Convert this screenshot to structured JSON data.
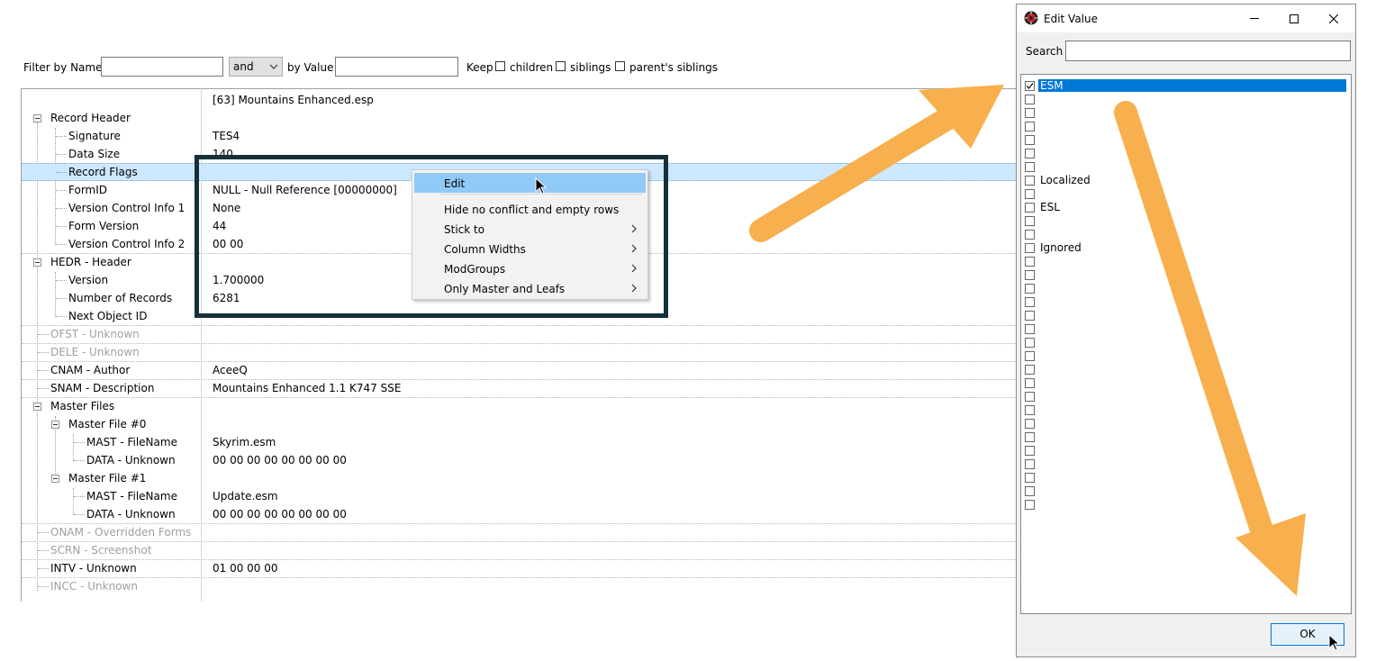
{
  "filter": {
    "name_label": "Filter by Name:",
    "name_value": "",
    "combo_value": "and",
    "value_label": "by Value:",
    "value_value": "",
    "keep_label": "Keep",
    "children_label": "children",
    "siblings_label": "siblings",
    "parents_siblings_label": "parent's siblings"
  },
  "grid": {
    "header_value": "[63] Mountains Enhanced.esp",
    "rows": {
      "record_header": "Record Header",
      "signature": "Signature",
      "signature_val": "TES4",
      "data_size": "Data Size",
      "data_size_val": "140",
      "record_flags": "Record Flags",
      "formid": "FormID",
      "formid_val": "NULL - Null Reference [00000000]",
      "vci1": "Version Control Info 1",
      "vci1_val": "None",
      "form_version": "Form Version",
      "form_version_val": "44",
      "vci2": "Version Control Info 2",
      "vci2_val": "00 00",
      "hedr": "HEDR - Header",
      "version": "Version",
      "version_val": "1.700000",
      "num_records": "Number of Records",
      "num_records_val": "6281",
      "next_object": "Next Object ID",
      "ofst": "OFST - Unknown",
      "dele": "DELE - Unknown",
      "cnam": "CNAM - Author",
      "cnam_val": "AceeQ",
      "snam": "SNAM - Description",
      "snam_val": "Mountains Enhanced 1.1 K747 SSE",
      "master_files": "Master Files",
      "master0": "Master File #0",
      "mast0": "MAST - FileName",
      "mast0_val": "Skyrim.esm",
      "data0": "DATA - Unknown",
      "data0_val": "00 00 00 00 00 00 00 00",
      "master1": "Master File #1",
      "mast1": "MAST - FileName",
      "mast1_val": "Update.esm",
      "data1": "DATA - Unknown",
      "data1_val": "00 00 00 00 00 00 00 00",
      "onam": "ONAM - Overridden Forms",
      "scrn": "SCRN - Screenshot",
      "intv": "INTV - Unknown",
      "intv_val": "01 00 00 00",
      "incc": "INCC - Unknown"
    }
  },
  "context_menu": {
    "items": [
      "Edit",
      "Hide no conflict and empty rows",
      "Stick to",
      "Column Widths",
      "ModGroups",
      "Only Master and Leafs"
    ]
  },
  "dialog": {
    "title": "Edit Value",
    "search_label": "Search",
    "search_value": "",
    "flags": {
      "esm": "ESM",
      "localized": "Localized",
      "esl": "ESL",
      "ignored": "Ignored"
    },
    "ok_label": "OK"
  },
  "colors": {
    "selection_row": "#cce8ff",
    "menu_highlight": "#91c9f7",
    "list_selection": "#0078d7",
    "frame": "#16303b",
    "arrow": "#f7b04d"
  }
}
